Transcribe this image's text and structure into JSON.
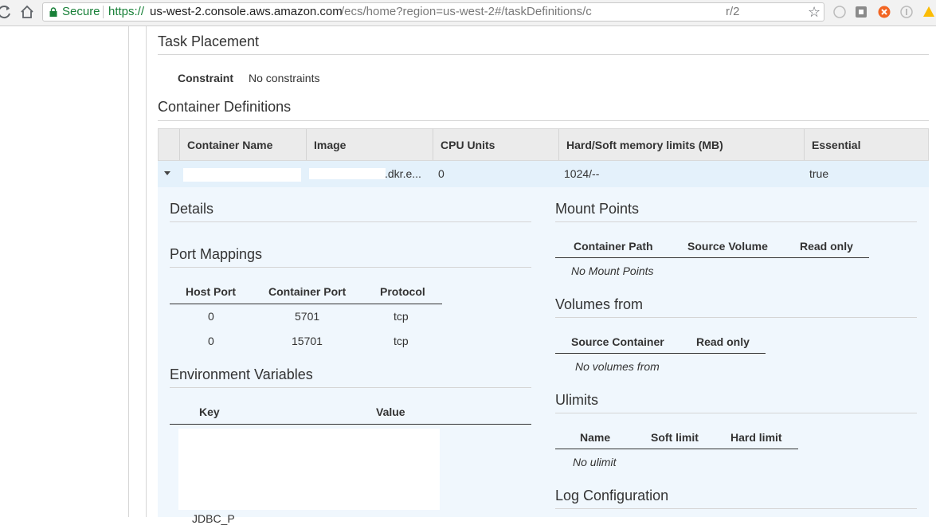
{
  "browser": {
    "secure_label": "Secure",
    "url_scheme": "https://",
    "url_host": "us-west-2.console.aws.amazon.com",
    "url_path": "/ecs/home?region=us-west-2#/taskDefinitions/c",
    "url_suffix": "r/2"
  },
  "task_placement": {
    "heading": "Task Placement",
    "constraint_label": "Constraint",
    "constraint_value": "No constraints"
  },
  "container_definitions": {
    "heading": "Container Definitions",
    "columns": [
      "Container Name",
      "Image",
      "CPU Units",
      "Hard/Soft memory limits (MB)",
      "Essential"
    ],
    "rows": [
      {
        "container_name": "",
        "image": ".dkr.e...",
        "cpu_units": "0",
        "memory": "1024/--",
        "essential": "true"
      }
    ]
  },
  "details": {
    "heading": "Details",
    "port_mappings": {
      "heading": "Port Mappings",
      "columns": [
        "Host Port",
        "Container Port",
        "Protocol"
      ],
      "rows": [
        {
          "host_port": "0",
          "container_port": "5701",
          "protocol": "tcp"
        },
        {
          "host_port": "0",
          "container_port": "15701",
          "protocol": "tcp"
        }
      ]
    },
    "environment_variables": {
      "heading": "Environment Variables",
      "columns": [
        "Key",
        "Value"
      ],
      "partial_text": "JDBC_P"
    }
  },
  "mount_points": {
    "heading": "Mount Points",
    "columns": [
      "Container Path",
      "Source Volume",
      "Read only"
    ],
    "empty_text": "No Mount Points"
  },
  "volumes_from": {
    "heading": "Volumes from",
    "columns": [
      "Source Container",
      "Read only"
    ],
    "empty_text": "No volumes from"
  },
  "ulimits": {
    "heading": "Ulimits",
    "columns": [
      "Name",
      "Soft limit",
      "Hard limit"
    ],
    "empty_text": "No ulimit"
  },
  "log_configuration": {
    "heading": "Log Configuration"
  },
  "icons": {
    "reload": "reload-icon",
    "home": "home-icon",
    "lock": "lock-icon",
    "star": "bookmark-star-icon",
    "caret": "caret-down-icon"
  },
  "colors": {
    "secure_green": "#188038",
    "header_bg": "#ebebeb",
    "selected_row_bg": "#e4f1fb",
    "detail_bg": "#f0f7fd"
  }
}
